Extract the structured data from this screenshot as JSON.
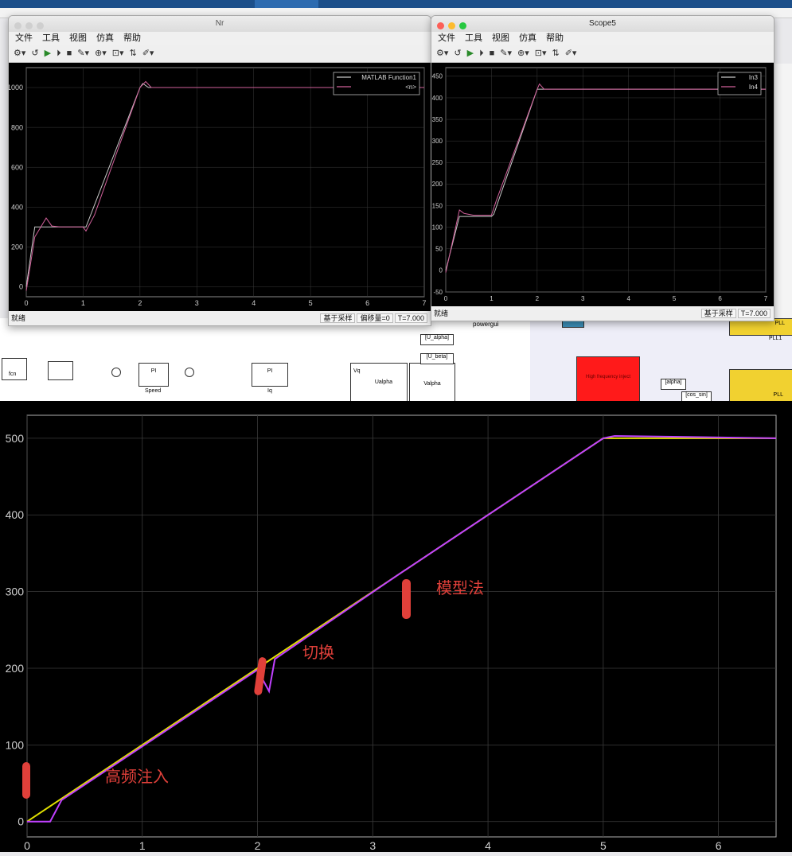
{
  "win_nr": {
    "title": "Nr",
    "menu": [
      "文件",
      "工具",
      "视图",
      "仿真",
      "帮助"
    ],
    "status_left": "就绪",
    "status_sample": "基于采样",
    "status_offset": "偏移量=0",
    "status_time": "T=7.000",
    "legend": [
      "MATLAB Function1",
      "<n>"
    ]
  },
  "win_scope5": {
    "title": "Scope5",
    "menu": [
      "文件",
      "工具",
      "视图",
      "仿真",
      "帮助"
    ],
    "status_left": "就绪",
    "status_sample": "基于采样",
    "status_time": "T=7.000",
    "legend": [
      "In3",
      "In4"
    ]
  },
  "canvas": {
    "powergui": "powergui",
    "fcn": "fcn",
    "pi1": "PI",
    "speed": "Speed",
    "pi2": "PI",
    "iq": "Iq",
    "vq": "Vq",
    "ualpha": "Ualpha",
    "valpha": "Valpha",
    "u_alpha_tag": "[U_alpha]",
    "u_beta_tag": "[U_beta]",
    "alpha_tag": "[alpha]",
    "cos_sin_tag": "[cos_sin]",
    "pll1": "PLL1",
    "pll": "PLL",
    "pll_top": "PLL",
    "high_freq": "High frequency inject"
  },
  "annotations": {
    "hf_injection": "高频注入",
    "switch": "切换",
    "model_method": "模型法"
  },
  "chart_data": [
    {
      "type": "line",
      "title": "",
      "xlim": [
        0,
        7
      ],
      "ylim": [
        -50,
        1100
      ],
      "x_ticks": [
        "0",
        "1",
        "2",
        "3",
        "4",
        "5",
        "6",
        "7"
      ],
      "y_ticks": [
        "0",
        "200",
        "400",
        "600",
        "800",
        "1000"
      ],
      "grid": true,
      "legend_position": "top-right",
      "series": [
        {
          "name": "MATLAB Function1",
          "color": "#c8c8c8",
          "x": [
            0,
            0.15,
            0.3,
            1.0,
            1.05,
            2.0,
            2.05,
            2.15,
            7
          ],
          "y": [
            0,
            300,
            300,
            300,
            300,
            1000,
            1020,
            1000,
            1000
          ]
        },
        {
          "name": "<n>",
          "color": "#d0609a",
          "x": [
            0,
            0.15,
            0.35,
            0.45,
            0.6,
            1.0,
            1.05,
            1.2,
            2.0,
            2.1,
            2.2,
            7
          ],
          "y": [
            -20,
            250,
            345,
            305,
            300,
            300,
            280,
            360,
            1000,
            1030,
            1000,
            1000
          ]
        }
      ]
    },
    {
      "type": "line",
      "title": "",
      "xlim": [
        0,
        7
      ],
      "ylim": [
        -50,
        470
      ],
      "x_ticks": [
        "0",
        "1",
        "2",
        "3",
        "4",
        "5",
        "6",
        "7"
      ],
      "y_ticks": [
        "-50",
        "0",
        "50",
        "100",
        "150",
        "200",
        "250",
        "300",
        "350",
        "400",
        "450"
      ],
      "grid": true,
      "legend_position": "top-right",
      "series": [
        {
          "name": "In3",
          "color": "#c8c8c8",
          "x": [
            0,
            0.3,
            1.0,
            1.05,
            2.0,
            7
          ],
          "y": [
            0,
            125,
            125,
            130,
            420,
            420
          ]
        },
        {
          "name": "In4",
          "color": "#d0609a",
          "x": [
            0,
            0.3,
            0.4,
            0.6,
            1.0,
            1.1,
            2.0,
            2.05,
            2.15,
            7
          ],
          "y": [
            -5,
            140,
            132,
            128,
            128,
            160,
            420,
            432,
            420,
            420
          ]
        }
      ]
    },
    {
      "type": "line",
      "title": "",
      "xlim": [
        0,
        6.5
      ],
      "ylim": [
        -20,
        530
      ],
      "x_ticks": [
        "0",
        "1",
        "2",
        "3",
        "4",
        "5",
        "6"
      ],
      "y_ticks": [
        "0",
        "100",
        "200",
        "300",
        "400",
        "500"
      ],
      "grid": true,
      "series": [
        {
          "color": "#e0e000",
          "x": [
            0,
            0.3,
            2.0,
            3.2,
            5.0,
            6.5
          ],
          "y": [
            0,
            30,
            200,
            320,
            500,
            500
          ]
        },
        {
          "color": "#c040ff",
          "x": [
            0,
            0.2,
            0.3,
            2.0,
            2.1,
            2.15,
            3.2,
            5.0,
            5.1,
            6.5
          ],
          "y": [
            0,
            0,
            28,
            198,
            170,
            212,
            320,
            500,
            503,
            500
          ]
        }
      ]
    }
  ],
  "colors": {
    "plot_bg": "#000000",
    "grid": "#3a3a3a",
    "axis_text": "#cfcfcf",
    "annotation_red": "#e0403a"
  }
}
